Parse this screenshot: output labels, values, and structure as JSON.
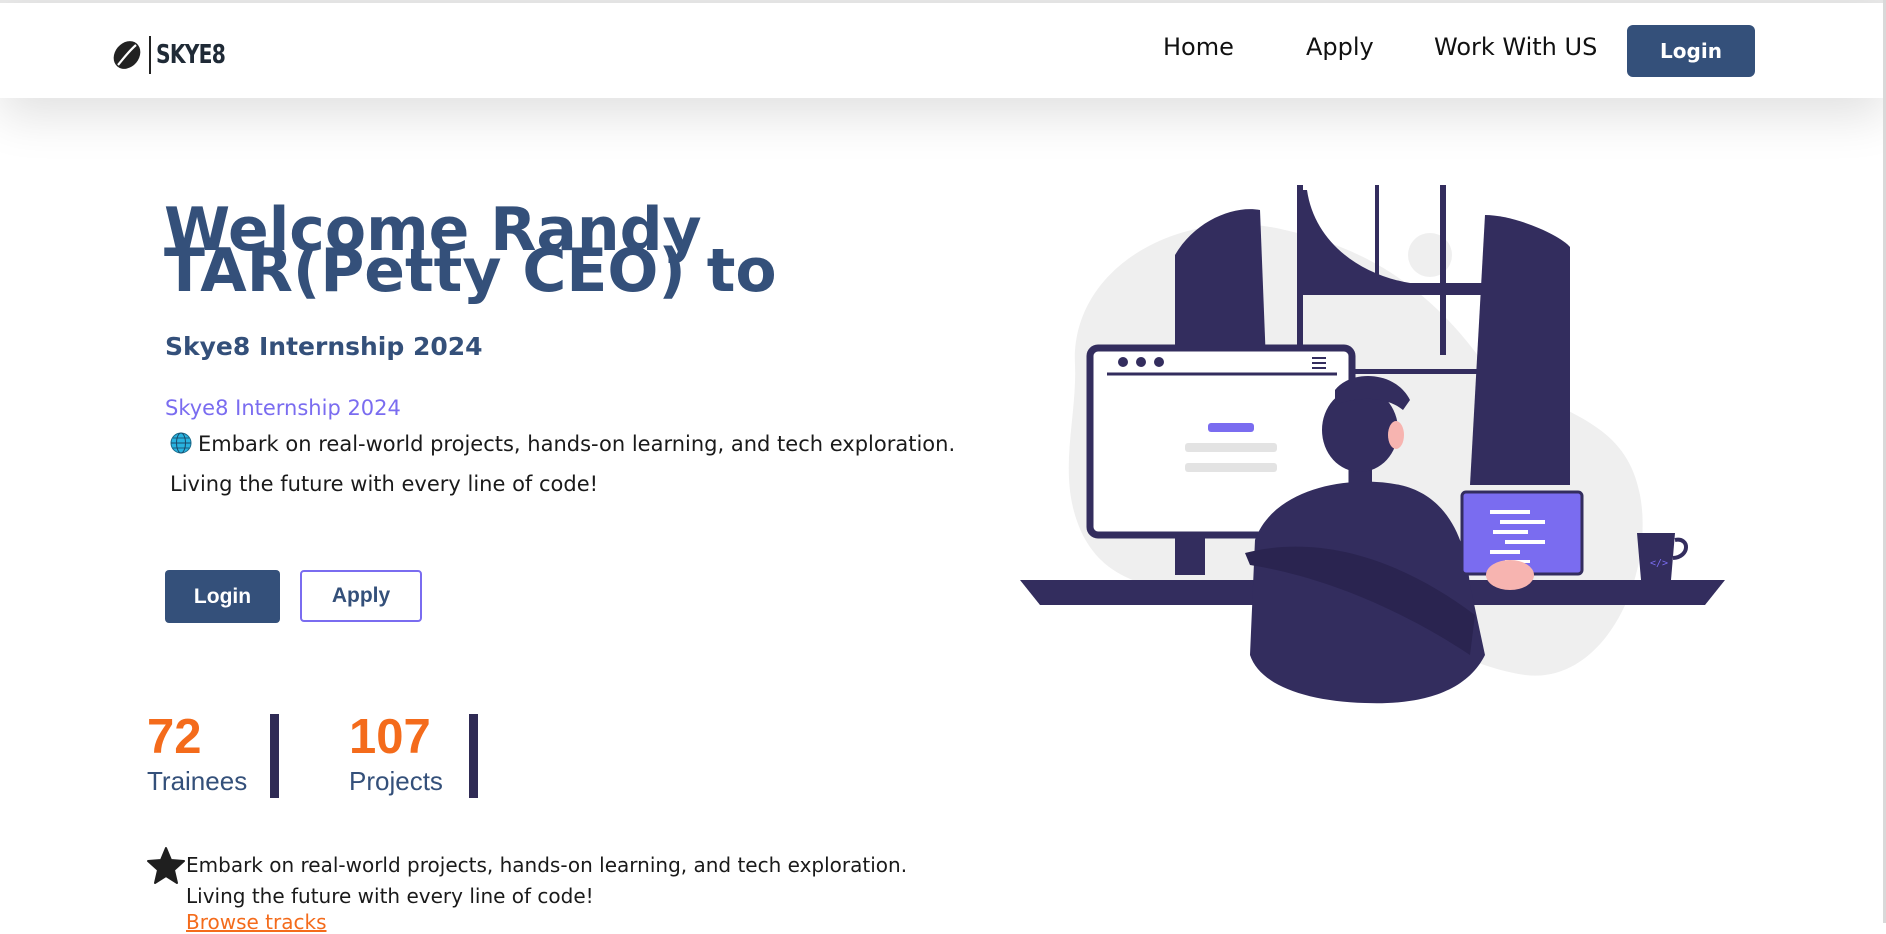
{
  "brand": {
    "logo_text": "SKYE8"
  },
  "nav": {
    "links": [
      "Home",
      "Apply",
      "Work With US"
    ],
    "login_label": "Login"
  },
  "hero": {
    "title": "Welcome Randy TAR(Petty CEO) to",
    "subtitle": "Skye8 Internship 2024",
    "tagline": "Skye8 Internship 2024",
    "description": "Embark on real-world projects, hands-on learning, and tech exploration. Living the future with every line of code!",
    "buttons": {
      "login": "Login",
      "apply": "Apply"
    }
  },
  "stats": [
    {
      "value": "72",
      "label": "Trainees"
    },
    {
      "value": "107",
      "label": "Projects"
    }
  ],
  "feature": {
    "text": "Embark on real-world projects, hands-on learning, and tech exploration. Living the future with every line of code!",
    "link": "Browse tracks"
  },
  "colors": {
    "primary": "#34507a",
    "accent": "#7a6cf0",
    "orange": "#f46b1b",
    "illustration_dark": "#332d5e"
  },
  "icons": {
    "logo": "coffee-bean-icon",
    "globe": "globe-icon",
    "star": "star-icon"
  }
}
